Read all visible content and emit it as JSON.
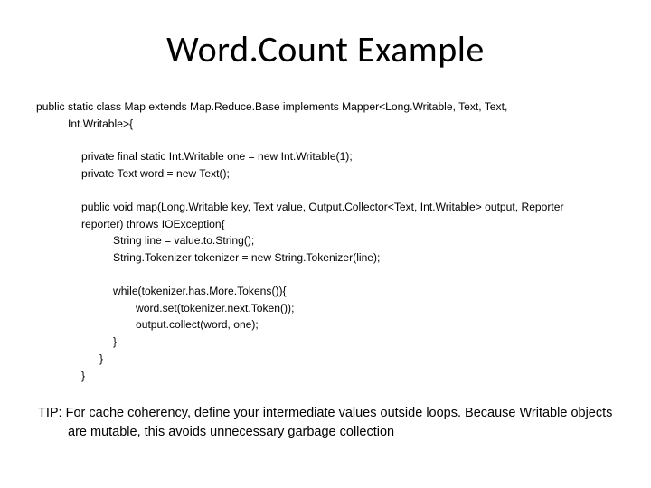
{
  "title": "Word.Count Example",
  "code": {
    "l1a": "public static class Map extends Map.Reduce.Base implements Mapper<Long.Writable, Text, Text,",
    "l1b": "Int.Writable>{",
    "l2a": "private final static Int.Writable one =  new Int.Writable(1);",
    "l2b": "private Text word = new Text();",
    "l3a": "public void map(Long.Writable key, Text value, Output.Collector<Text, Int.Writable> output, Reporter",
    "l3b": "reporter) throws IOException{",
    "l4a": "String line = value.to.String();",
    "l4b": "String.Tokenizer tokenizer = new String.Tokenizer(line);",
    "l5a": "while(tokenizer.has.More.Tokens()){",
    "l6a": "word.set(tokenizer.next.Token());",
    "l6b": "output.collect(word, one);",
    "l7a": "}",
    "l8a": "}",
    "l9a": "}"
  },
  "tip": "TIP: For cache coherency, define your intermediate values outside loops. Because Writable objects are mutable, this avoids unnecessary garbage collection"
}
